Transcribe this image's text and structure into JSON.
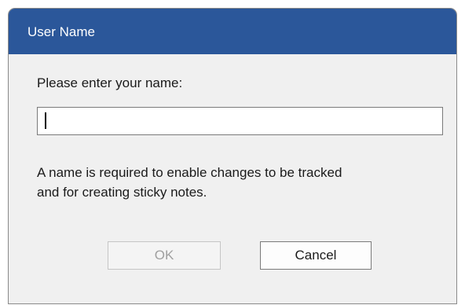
{
  "dialog": {
    "title": "User Name",
    "prompt": "Please enter your name:",
    "name_input": {
      "value": "",
      "placeholder": ""
    },
    "info_line1": "A name is required to enable changes to be tracked",
    "info_line2": "and for creating sticky notes.",
    "ok_label": "OK",
    "cancel_label": "Cancel",
    "ok_enabled": false
  },
  "colors": {
    "titlebar": "#2b579a",
    "dialog_background": "#f0f0f0",
    "disabled_text": "#a0a0a0"
  }
}
